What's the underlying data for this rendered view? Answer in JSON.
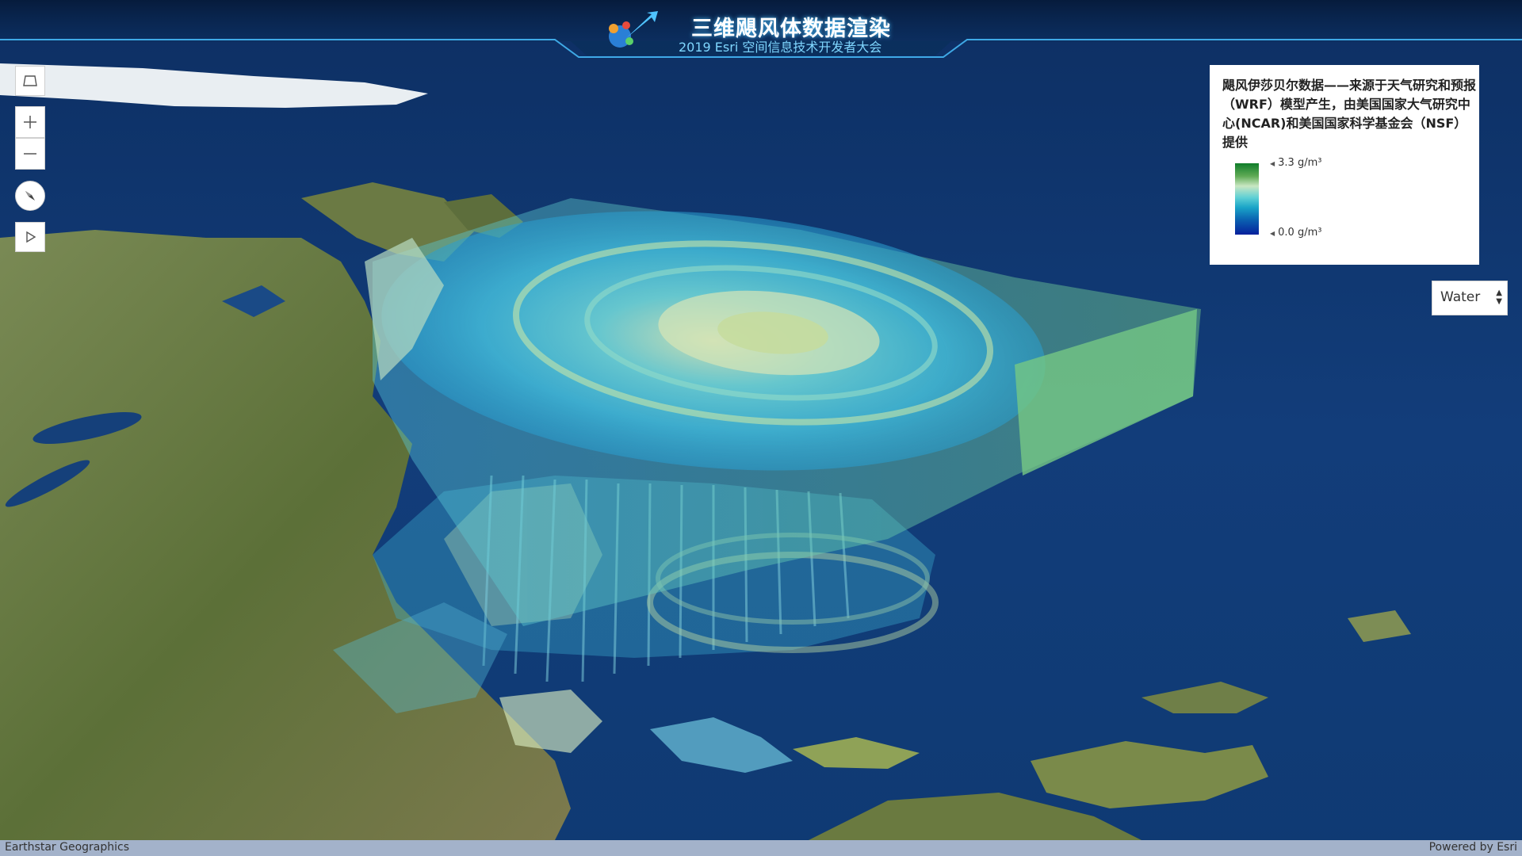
{
  "header": {
    "title": "三维飓风体数据渲染",
    "subtitle": "2019 Esri 空间信息技术开发者大会"
  },
  "toolbar": {
    "items": [
      {
        "icon": "select-area-icon"
      },
      {
        "icon": "zoom-in-icon"
      },
      {
        "icon": "zoom-out-icon"
      },
      {
        "icon": "compass-icon"
      },
      {
        "icon": "play-icon"
      }
    ]
  },
  "legend": {
    "title": "飓风伊莎贝尔数据——来源于天气研究和预报（WRF）模型产生，由美国国家大气研究中心(NCAR)和美国国家科学基金会（NSF）提供",
    "max_label": "3.3 g/m³",
    "min_label": "0.0 g/m³",
    "ramp_colors": [
      "#0f7d2a",
      "#c9e7c2",
      "#1aa4c8",
      "#06209c"
    ]
  },
  "variable_select": {
    "selected": "Water"
  },
  "footer": {
    "attribution": "Earthstar Geographics",
    "powered_by": "Powered by Esri"
  },
  "colors": {
    "ocean": "#123d7a",
    "land": "#6f7d45",
    "volume": "#4fd2e6",
    "header_glow": "#4fc3ff"
  }
}
